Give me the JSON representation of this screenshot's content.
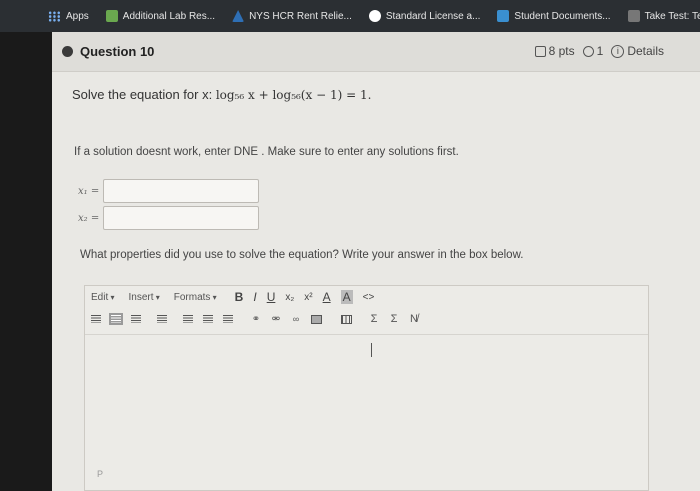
{
  "bookmarks": [
    {
      "label": "Apps",
      "icon": "apps-grid-icon",
      "color": "#7ab0f0"
    },
    {
      "label": "Additional Lab Res...",
      "icon": "canvas-bookmark-icon",
      "color": "#6aa84f"
    },
    {
      "label": "NYS HCR Rent Relie...",
      "icon": "nys-bookmark-icon",
      "color": "#2e6fb5"
    },
    {
      "label": "Standard License a...",
      "icon": "license-bookmark-icon",
      "color": "#ffffff"
    },
    {
      "label": "Student Documents...",
      "icon": "documents-bookmark-icon",
      "color": "#3a8fd0"
    },
    {
      "label": "Take Test: Te",
      "icon": "test-bookmark-icon",
      "color": "#777777"
    }
  ],
  "question": {
    "title": "Question 10",
    "points": "8 pts",
    "attempts": "1",
    "details": "Details",
    "prompt_lead": "Solve the equation for x: ",
    "equation": "log₅₆ x + log₅₆(x − 1) = 1.",
    "note": "If a solution doesnt work, enter DNE . Make sure to enter any solutions first.",
    "x1_label": "x₁ =",
    "x2_label": "x₂ =",
    "x1_value": "",
    "x2_value": "",
    "properties_prompt": "What properties did you use to solve the equation? Write your answer in the box below."
  },
  "editor": {
    "menus": [
      "Edit",
      "Insert",
      "Formats"
    ],
    "format_buttons": [
      "B",
      "I",
      "U",
      "x₂",
      "x²",
      "A",
      "A",
      "<>"
    ],
    "toolbar2_buttons": [
      "Σ",
      "Σ",
      "N̸"
    ],
    "path_label": "P"
  }
}
